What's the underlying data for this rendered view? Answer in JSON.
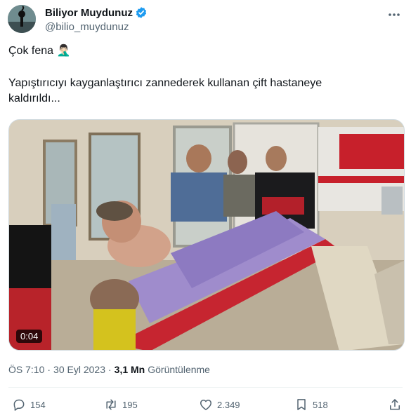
{
  "author": {
    "display_name": "Biliyor Muydunuz",
    "handle": "@bilio_muydunuz",
    "verified_color": "#1d9bf0"
  },
  "tweet": {
    "line1": "Çok fena 🤦🏻‍♂️",
    "line2": "Yapıştırıcıyı kayganlaştırıcı zannederek kullanan çift hastaneye\nkaldırıldı..."
  },
  "media": {
    "duration": "0:04"
  },
  "meta": {
    "time": "ÖS 7:10",
    "sep": "·",
    "date": "30 Eyl 2023",
    "views_count": "3,1 Mn",
    "views_label": "Görüntülenme"
  },
  "actions": {
    "replies": "154",
    "retweets": "195",
    "likes": "2.349",
    "bookmarks": "518"
  },
  "icons": [
    "more-icon",
    "verified-icon",
    "reply-icon",
    "retweet-icon",
    "like-icon",
    "bookmark-icon",
    "share-icon"
  ]
}
